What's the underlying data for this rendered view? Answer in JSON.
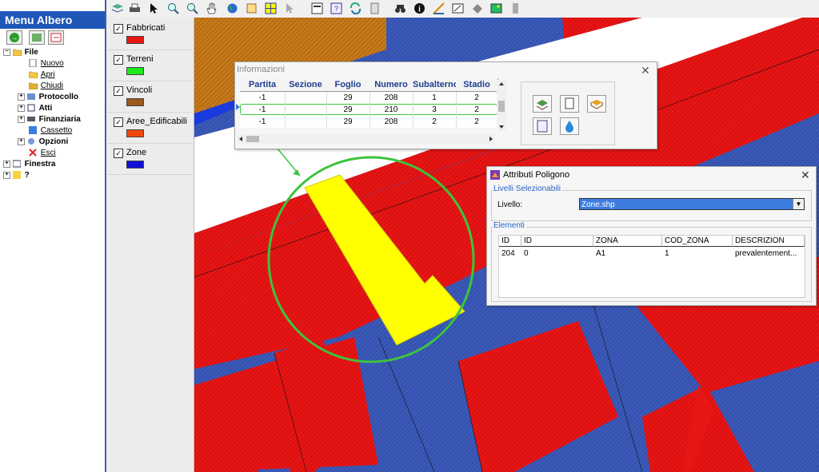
{
  "tree": {
    "title": "Menu Albero",
    "items": [
      {
        "label": "File"
      },
      {
        "label": "Nuovo"
      },
      {
        "label": "Apri"
      },
      {
        "label": "Chiudi"
      },
      {
        "label": "Protocollo"
      },
      {
        "label": "Atti"
      },
      {
        "label": "Finanziaria"
      },
      {
        "label": "Cassetto"
      },
      {
        "label": "Opzioni"
      },
      {
        "label": "Esci"
      },
      {
        "label": "Finestra"
      },
      {
        "label": "?"
      }
    ]
  },
  "layers": [
    {
      "name": "Fabbricati",
      "checked": "✓",
      "color": "#e81515"
    },
    {
      "name": "Terreni",
      "checked": "✓",
      "color": "#1ee81e"
    },
    {
      "name": "Vincoli",
      "checked": "✓",
      "color": "#9b5a1c"
    },
    {
      "name": "Aree_Edificabili",
      "checked": "✓",
      "color": "#f04a10"
    },
    {
      "name": "Zone",
      "checked": "✓",
      "color": "#1010d8"
    }
  ],
  "info": {
    "title": "Informazioni",
    "close": "✕",
    "columns": [
      "Partita",
      "Sezione",
      "Foglio",
      "Numero",
      "Subalterno",
      "Stadio"
    ],
    "rows": [
      [
        "-1",
        "",
        "29",
        "208",
        "1",
        "2"
      ],
      [
        "-1",
        "",
        "29",
        "210",
        "3",
        "2"
      ],
      [
        "-1",
        "",
        "29",
        "208",
        "2",
        "2"
      ]
    ]
  },
  "attr": {
    "title": "Attributi Poligono",
    "close": "✕",
    "group1": "Livelli Selezionabili",
    "livello_label": "Livello:",
    "livello_value": "Zone.shp",
    "group2": "Elementi",
    "columns": [
      "ID",
      "ID",
      "ZONA",
      "COD_ZONA",
      "DESCRIZION"
    ],
    "row": [
      "204",
      "0",
      "A1",
      "1",
      "prevalentement..."
    ]
  },
  "colors": {
    "accent": "#1f56b8",
    "highlight_circle": "#3cc43c",
    "selection": "#ffff00"
  }
}
